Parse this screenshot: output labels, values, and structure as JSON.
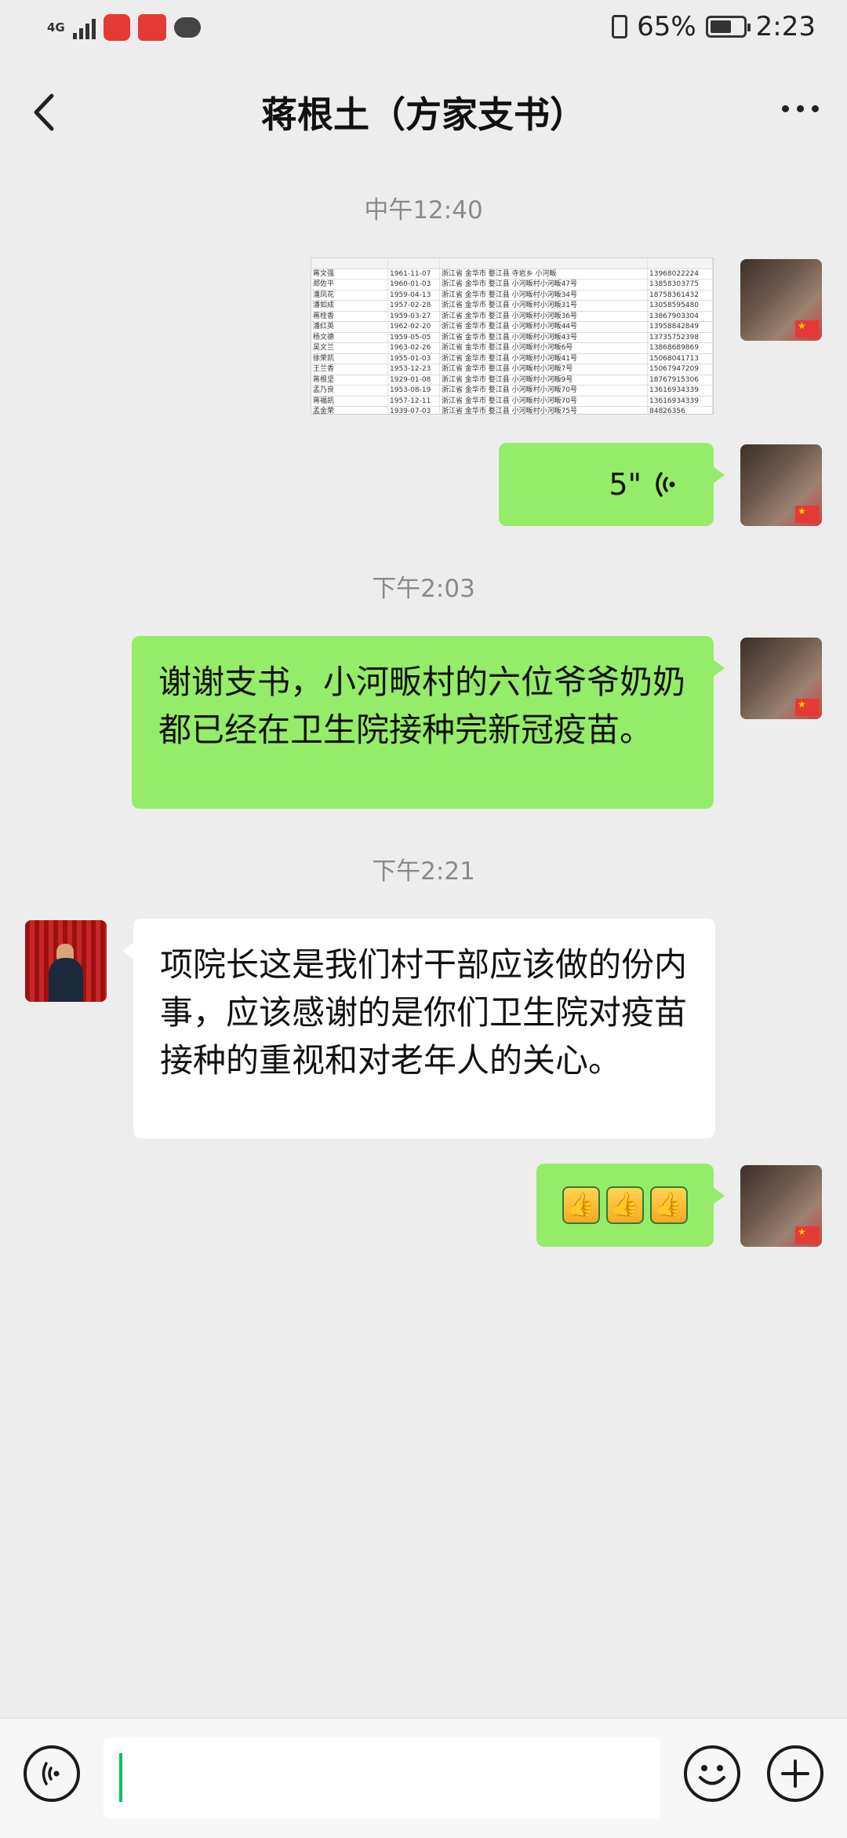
{
  "status_bar": {
    "network": "4G",
    "battery_percent": "65%",
    "battery_level": 0.65,
    "time": "2:23"
  },
  "header": {
    "back_icon": "chevron-left-icon",
    "title": "蒋根土（方家支书）",
    "more_icon": "more-dots-icon"
  },
  "messages": [
    {
      "type": "timestamp",
      "text": "中午12:40"
    },
    {
      "type": "image",
      "sender": "me",
      "description_icon": "spreadsheet-thumbnail",
      "rows": [
        [
          "蒋文强",
          "1961-11-07",
          "浙江省 金华市 婺江县 寺岩乡 小河畈",
          "13968022224"
        ],
        [
          "郑佐平",
          "1960-01-03",
          "浙江省 金华市 婺江县 小河畈村小河畈47号",
          "13858303775"
        ],
        [
          "潘凤花",
          "1959-04-13",
          "浙江省 金华市 婺江县 小河畈村小河畈34号",
          "18758361432"
        ],
        [
          "潘如成",
          "1957-02-28",
          "浙江省 金华市 婺江县 小河畈村小河畈31号",
          "13058595480"
        ],
        [
          "蒋桂香",
          "1959-03-27",
          "浙江省 金华市 婺江县 小河畈村小河畈36号",
          "13867903304"
        ],
        [
          "潘红英",
          "1962-02-20",
          "浙江省 金华市 婺江县 小河畈村小河畈44号",
          "13958842849"
        ],
        [
          "杨文德",
          "1959-05-05",
          "浙江省 金华市 婺江县 小河畈村小河畈43号",
          "13735752398"
        ],
        [
          "吴文兰",
          "1963-02-26",
          "浙江省 金华市 婺江县 小河畈村小河畈6号",
          "13868689869"
        ],
        [
          "徐荣凯",
          "1955-01-03",
          "浙江省 金华市 婺江县 小河畈村小河畈41号",
          "15068041713"
        ],
        [
          "王兰香",
          "1953-12-23",
          "浙江省 金华市 婺江县 小河畈村小河畈7号",
          "15067947209"
        ],
        [
          "蒋根坚",
          "1929-01-08",
          "浙江省 金华市 婺江县 小河畈村小河畈9号",
          "18767915306"
        ],
        [
          "孟乃良",
          "1953-08-19",
          "浙江省 金华市 婺江县 小河畈村小河畈70号",
          "13616934339"
        ],
        [
          "蒋福凯",
          "1957-12-11",
          "浙江省 金华市 婺江县 小河畈村小河畈70号",
          "13616934339"
        ],
        [
          "孟金荣",
          "1939-07-03",
          "浙江省 金华市 婺江县 小河畈村小河畈75号",
          "84826356"
        ]
      ]
    },
    {
      "type": "voice",
      "sender": "me",
      "duration": "5\""
    },
    {
      "type": "timestamp",
      "text": "下午2:03"
    },
    {
      "type": "text",
      "sender": "me",
      "text": "谢谢支书，小河畈村的六位爷爷奶奶都已经在卫生院接种完新冠疫苗。"
    },
    {
      "type": "timestamp",
      "text": "下午2:21"
    },
    {
      "type": "text",
      "sender": "other",
      "text": "项院长这是我们村干部应该做的份内事，应该感谢的是你们卫生院对疫苗接种的重视和对老年人的关心。"
    },
    {
      "type": "emoji",
      "sender": "me",
      "icons": [
        "thumbs-up-icon",
        "thumbs-up-icon",
        "thumbs-up-icon"
      ]
    }
  ],
  "input_bar": {
    "voice_icon": "voice-input-icon",
    "emoji_icon": "emoji-smile-icon",
    "plus_icon": "plus-icon",
    "text_value": ""
  },
  "colors": {
    "background": "#ededed",
    "my_bubble": "#95ec69",
    "their_bubble": "#ffffff",
    "accent": "#07c160"
  }
}
